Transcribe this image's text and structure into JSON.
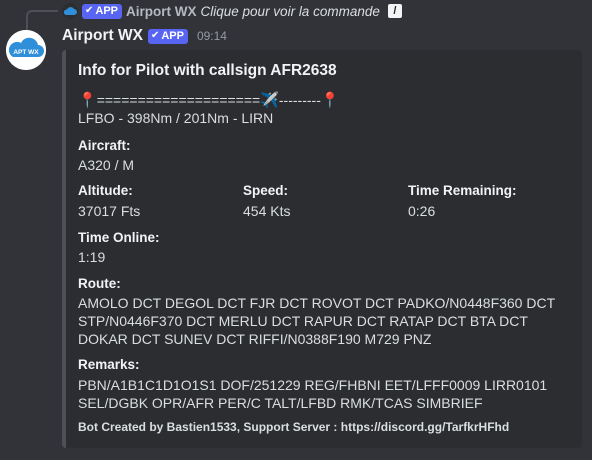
{
  "reply": {
    "badge": "APP",
    "author": "Airport WX",
    "text": "Clique pour voir la commande"
  },
  "message": {
    "author": "Airport WX",
    "badge": "APP",
    "timestamp": "09:14",
    "avatar_label": "APT WX"
  },
  "embed": {
    "title": "Info for Pilot with callsign AFR2638",
    "progress_left": "====================",
    "progress_right": "---------",
    "route_summary": "LFBO - 398Nm / 201Nm - LIRN",
    "aircraft_label": "Aircraft:",
    "aircraft_value": "A320 / M",
    "altitude_label": "Altitude:",
    "altitude_value": "37017 Fts",
    "speed_label": "Speed:",
    "speed_value": "454 Kts",
    "time_remaining_label": "Time Remaining:",
    "time_remaining_value": "0:26",
    "time_online_label": "Time Online:",
    "time_online_value": "1:19",
    "route_label": "Route:",
    "route_value": "AMOLO DCT DEGOL DCT FJR DCT ROVOT DCT PADKO/N0448F360 DCT STP/N0446F370 DCT MERLU DCT RAPUR DCT RATAP DCT BTA DCT DOKAR DCT SUNEV DCT RIFFI/N0388F190 M729 PNZ",
    "remarks_label": "Remarks:",
    "remarks_value": "PBN/A1B1C1D1O1S1 DOF/251229 REG/FHBNI EET/LFFF0009 LIRR0101 SEL/DGBK OPR/AFR PER/C TALT/LFBD RMK/TCAS SIMBRIEF",
    "footer": "Bot Created by Bastien1533, Support Server : https://discord.gg/TarfkrHFhd"
  },
  "colors": {
    "background": "#313338",
    "embed_background": "#2b2d31",
    "badge": "#5865f2",
    "accent_blue": "#2f8fd8"
  },
  "icons": {
    "avatar": "cloud-icon",
    "pin": "round-pushpin-icon",
    "plane": "airplane-icon",
    "command": "slash-command-icon",
    "verified": "checkmark-icon"
  }
}
